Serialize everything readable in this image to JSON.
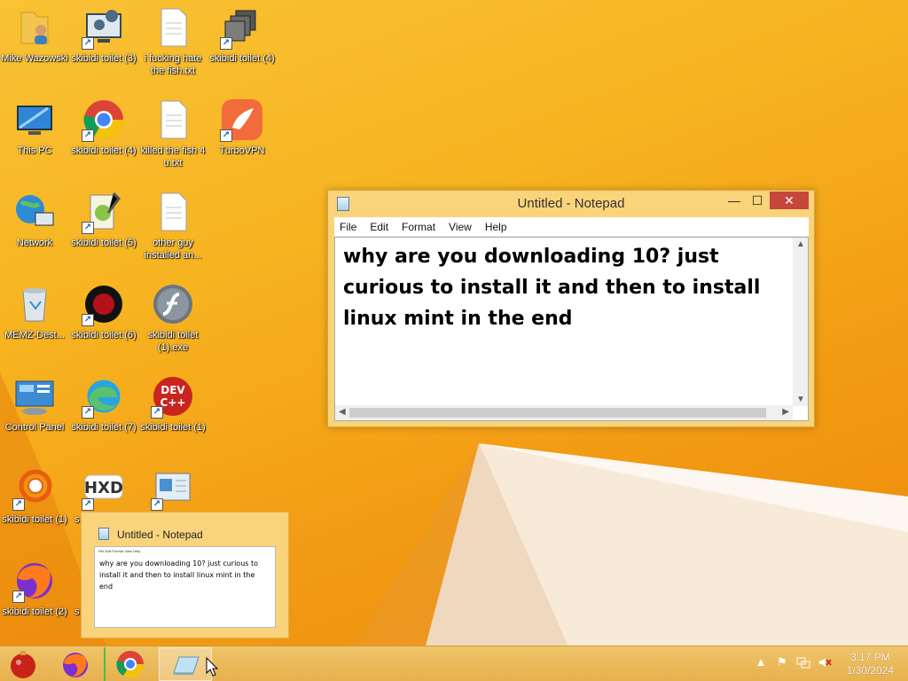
{
  "desktop": {
    "icons": [
      {
        "label": "Mike Wazowski"
      },
      {
        "label": "skibidi toilet (3)"
      },
      {
        "label": "i fucking hate the fish.txt"
      },
      {
        "label": "skibidi toilet (4)"
      },
      {
        "label": "This PC"
      },
      {
        "label": "skibidi toilet (4)"
      },
      {
        "label": "killed the fish 4 u.txt"
      },
      {
        "label": "TurboVPN"
      },
      {
        "label": "Network"
      },
      {
        "label": "skibidi toilet (5)"
      },
      {
        "label": "other guy installed an..."
      },
      {
        "label": "MEMZ-Dest..."
      },
      {
        "label": "skibidi toilet (6)"
      },
      {
        "label": "skibidi toilet (1).exe"
      },
      {
        "label": "Control Panel"
      },
      {
        "label": "skibidi toilet (7)"
      },
      {
        "label": "skibidi toilet (1)"
      },
      {
        "label": "skibidi toilet (1)"
      },
      {
        "label": "s"
      },
      {
        "label": ""
      },
      {
        "label": "skibidi toilet (2)"
      },
      {
        "label": "s"
      }
    ]
  },
  "notepad": {
    "title": "Untitled - Notepad",
    "menu": [
      "File",
      "Edit",
      "Format",
      "View",
      "Help"
    ],
    "content": "why are you downloading 10? just curious to install it and then to install linux mint in the end",
    "minimize": "—",
    "maximize": "☐",
    "close": "✕"
  },
  "preview": {
    "title": "Untitled - Notepad",
    "menu": "File  Edit  Format  View  Help",
    "content": "why are you downloading 10? just curious to install it and then to install linux mint in the end"
  },
  "taskbar": {
    "time": "3:17 PM",
    "date": "1/30/2024"
  }
}
